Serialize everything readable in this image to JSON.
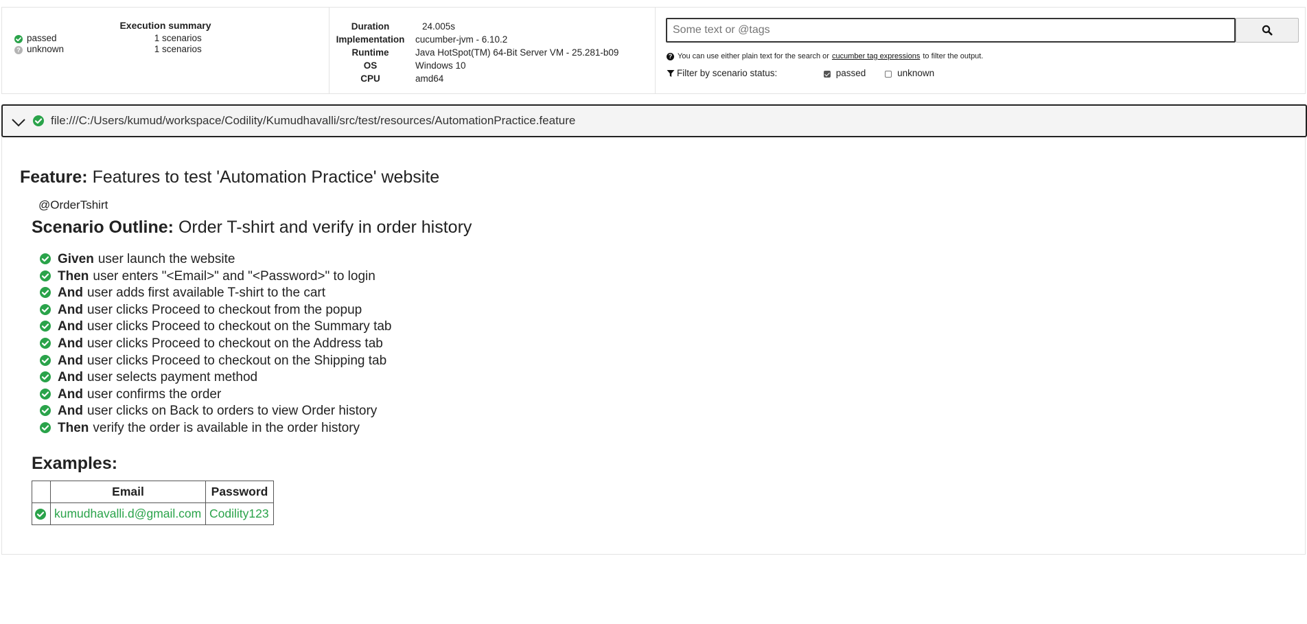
{
  "summary": {
    "title": "Execution summary",
    "rows": [
      {
        "label": "passed",
        "count": "1 scenarios",
        "status": "passed"
      },
      {
        "label": "unknown",
        "count": "1 scenarios",
        "status": "unknown"
      }
    ]
  },
  "environment": [
    {
      "key": "Duration",
      "value": "24.005s"
    },
    {
      "key": "Implementation",
      "value": "cucumber-jvm - 6.10.2"
    },
    {
      "key": "Runtime",
      "value": "Java HotSpot(TM) 64-Bit Server VM - 25.281-b09"
    },
    {
      "key": "OS",
      "value": "Windows 10"
    },
    {
      "key": "CPU",
      "value": "amd64"
    }
  ],
  "search": {
    "placeholder": "Some text or @tags",
    "value": "",
    "help_prefix": "You can use either plain text for the search or",
    "help_link": "cucumber tag expressions",
    "help_suffix": "to filter the output.",
    "filter_label": "Filter by scenario status:",
    "filters": [
      {
        "label": "passed",
        "checked": true
      },
      {
        "label": "unknown",
        "checked": false
      }
    ]
  },
  "feature": {
    "uri": "file:///C:/Users/kumud/workspace/Codility/Kumudhavalli/src/test/resources/AutomationPractice.feature",
    "keyword": "Feature:",
    "name": "Features to test 'Automation Practice' website",
    "scenario": {
      "tag": "@OrderTshirt",
      "keyword": "Scenario Outline:",
      "name": "Order T-shirt and verify in order history",
      "steps": [
        {
          "keyword": "Given",
          "text": "user launch the website"
        },
        {
          "keyword": "Then",
          "text": "user enters \"<Email>\" and \"<Password>\" to login"
        },
        {
          "keyword": "And",
          "text": "user adds first available T-shirt to the cart"
        },
        {
          "keyword": "And",
          "text": "user clicks Proceed to checkout from the popup"
        },
        {
          "keyword": "And",
          "text": "user clicks Proceed to checkout on the Summary tab"
        },
        {
          "keyword": "And",
          "text": "user clicks Proceed to checkout on the Address tab"
        },
        {
          "keyword": "And",
          "text": "user clicks Proceed to checkout on the Shipping tab"
        },
        {
          "keyword": "And",
          "text": "user selects payment method"
        },
        {
          "keyword": "And",
          "text": "user confirms the order"
        },
        {
          "keyword": "And",
          "text": "user clicks on Back to orders to view Order history"
        },
        {
          "keyword": "Then",
          "text": "verify the order is available in the order history"
        }
      ],
      "examples": {
        "title": "Examples:",
        "headers": [
          "Email",
          "Password"
        ],
        "rows": [
          {
            "status": "passed",
            "cells": [
              "kumudhavalli.d@gmail.com",
              "Codility123"
            ]
          }
        ]
      }
    }
  },
  "colors": {
    "passed": "#2aa34a",
    "unknown": "#b4b4b4",
    "file_bar": "#f4f4f4"
  },
  "icons": {
    "search_button": "search-icon",
    "help": "question-circle-icon",
    "filter": "filter-icon",
    "collapse": "chevron-down-icon",
    "status_passed": "check-circle-icon",
    "status_unknown": "question-circle-icon"
  }
}
